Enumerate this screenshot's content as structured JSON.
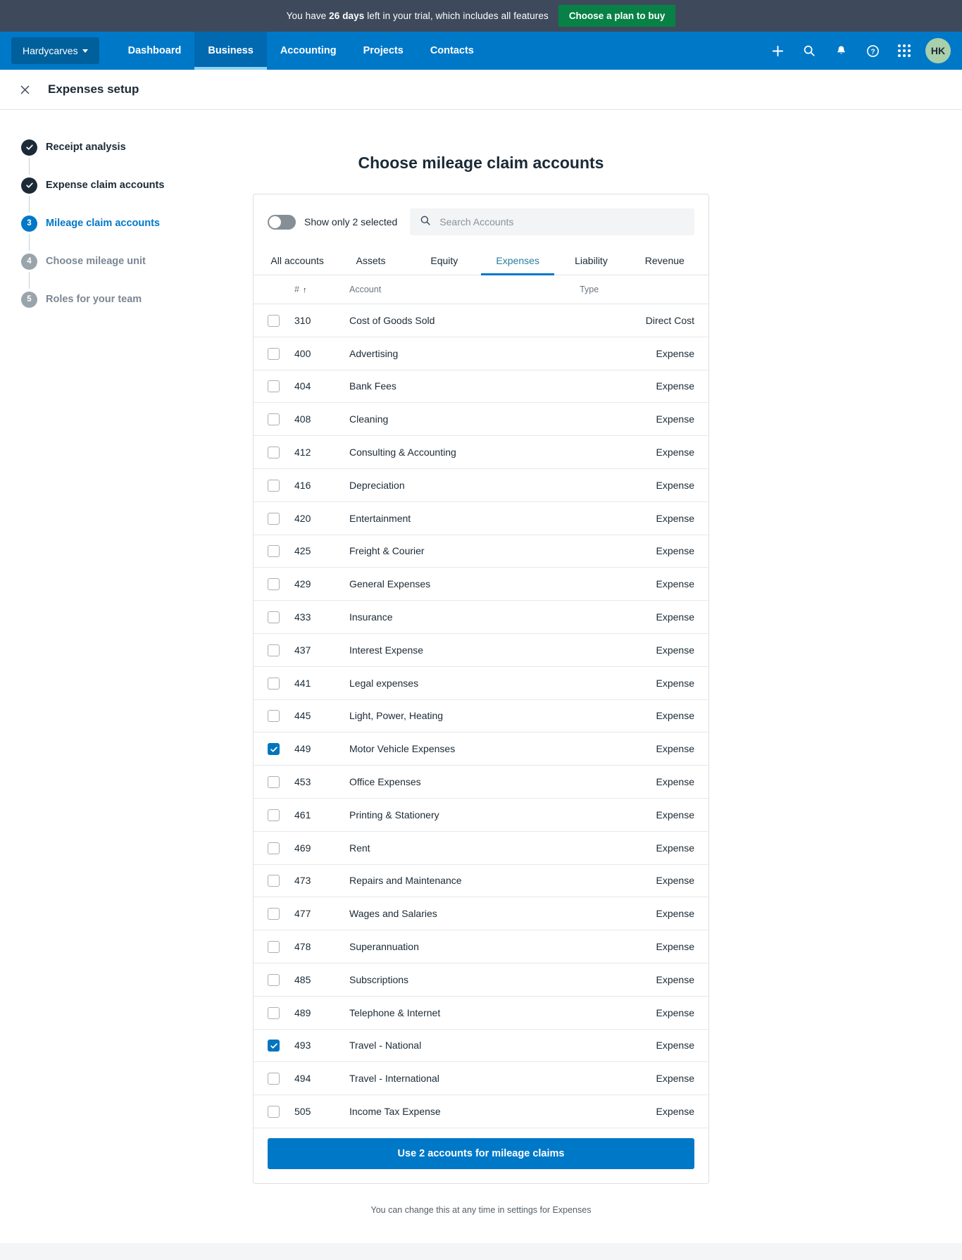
{
  "trial_banner": {
    "text_prefix": "You have ",
    "days": "26 days",
    "text_suffix": " left in your trial, which includes all features",
    "cta_label": "Choose a plan to buy",
    "cta_color": "#078145",
    "background": "#3e4a5b"
  },
  "navbar": {
    "org_name": "Hardycarves",
    "background": "#0078c8",
    "links": [
      {
        "label": "Dashboard",
        "active": false
      },
      {
        "label": "Business",
        "active": true
      },
      {
        "label": "Accounting",
        "active": false
      },
      {
        "label": "Projects",
        "active": false
      },
      {
        "label": "Contacts",
        "active": false
      }
    ],
    "icons": [
      {
        "name": "plus-icon"
      },
      {
        "name": "search-icon"
      },
      {
        "name": "bell-icon"
      },
      {
        "name": "help-icon"
      },
      {
        "name": "apps-grid-icon"
      }
    ],
    "avatar_initials": "HK"
  },
  "subheader": {
    "close_icon": "close-icon",
    "title": "Expenses setup"
  },
  "steps": [
    {
      "number": "1",
      "label": "Receipt analysis",
      "state": "done"
    },
    {
      "number": "2",
      "label": "Expense claim accounts",
      "state": "done"
    },
    {
      "number": "3",
      "label": "Mileage claim accounts",
      "state": "current"
    },
    {
      "number": "4",
      "label": "Choose mileage unit",
      "state": "todo"
    },
    {
      "number": "5",
      "label": "Roles for your team",
      "state": "todo"
    }
  ],
  "main": {
    "title": "Choose mileage claim accounts",
    "toggle": {
      "label": "Show only 2 selected",
      "on": false
    },
    "search": {
      "placeholder": "Search Accounts",
      "value": "",
      "icon": "search-icon"
    },
    "tabs": [
      {
        "label": "All accounts",
        "active": false
      },
      {
        "label": "Assets",
        "active": false
      },
      {
        "label": "Equity",
        "active": false
      },
      {
        "label": "Expenses",
        "active": true
      },
      {
        "label": "Liability",
        "active": false
      },
      {
        "label": "Revenue",
        "active": false
      }
    ],
    "table": {
      "headers": {
        "number": "#",
        "sort_indicator": "↑",
        "account": "Account",
        "type": "Type"
      },
      "rows": [
        {
          "number": "310",
          "account": "Cost of Goods Sold",
          "type": "Direct Cost",
          "checked": false
        },
        {
          "number": "400",
          "account": "Advertising",
          "type": "Expense",
          "checked": false
        },
        {
          "number": "404",
          "account": "Bank Fees",
          "type": "Expense",
          "checked": false
        },
        {
          "number": "408",
          "account": "Cleaning",
          "type": "Expense",
          "checked": false
        },
        {
          "number": "412",
          "account": "Consulting & Accounting",
          "type": "Expense",
          "checked": false
        },
        {
          "number": "416",
          "account": "Depreciation",
          "type": "Expense",
          "checked": false
        },
        {
          "number": "420",
          "account": "Entertainment",
          "type": "Expense",
          "checked": false
        },
        {
          "number": "425",
          "account": "Freight & Courier",
          "type": "Expense",
          "checked": false
        },
        {
          "number": "429",
          "account": "General Expenses",
          "type": "Expense",
          "checked": false
        },
        {
          "number": "433",
          "account": "Insurance",
          "type": "Expense",
          "checked": false
        },
        {
          "number": "437",
          "account": "Interest Expense",
          "type": "Expense",
          "checked": false
        },
        {
          "number": "441",
          "account": "Legal expenses",
          "type": "Expense",
          "checked": false
        },
        {
          "number": "445",
          "account": "Light, Power, Heating",
          "type": "Expense",
          "checked": false
        },
        {
          "number": "449",
          "account": "Motor Vehicle Expenses",
          "type": "Expense",
          "checked": true
        },
        {
          "number": "453",
          "account": "Office Expenses",
          "type": "Expense",
          "checked": false
        },
        {
          "number": "461",
          "account": "Printing & Stationery",
          "type": "Expense",
          "checked": false
        },
        {
          "number": "469",
          "account": "Rent",
          "type": "Expense",
          "checked": false
        },
        {
          "number": "473",
          "account": "Repairs and Maintenance",
          "type": "Expense",
          "checked": false
        },
        {
          "number": "477",
          "account": "Wages and Salaries",
          "type": "Expense",
          "checked": false
        },
        {
          "number": "478",
          "account": "Superannuation",
          "type": "Expense",
          "checked": false
        },
        {
          "number": "485",
          "account": "Subscriptions",
          "type": "Expense",
          "checked": false
        },
        {
          "number": "489",
          "account": "Telephone & Internet",
          "type": "Expense",
          "checked": false
        },
        {
          "number": "493",
          "account": "Travel - National",
          "type": "Expense",
          "checked": true
        },
        {
          "number": "494",
          "account": "Travel - International",
          "type": "Expense",
          "checked": false
        },
        {
          "number": "505",
          "account": "Income Tax Expense",
          "type": "Expense",
          "checked": false
        }
      ]
    },
    "primary_button": "Use 2 accounts for mileage claims",
    "footnote": "You can change this at any time in settings for Expenses",
    "accent_color": "#0078c8"
  }
}
